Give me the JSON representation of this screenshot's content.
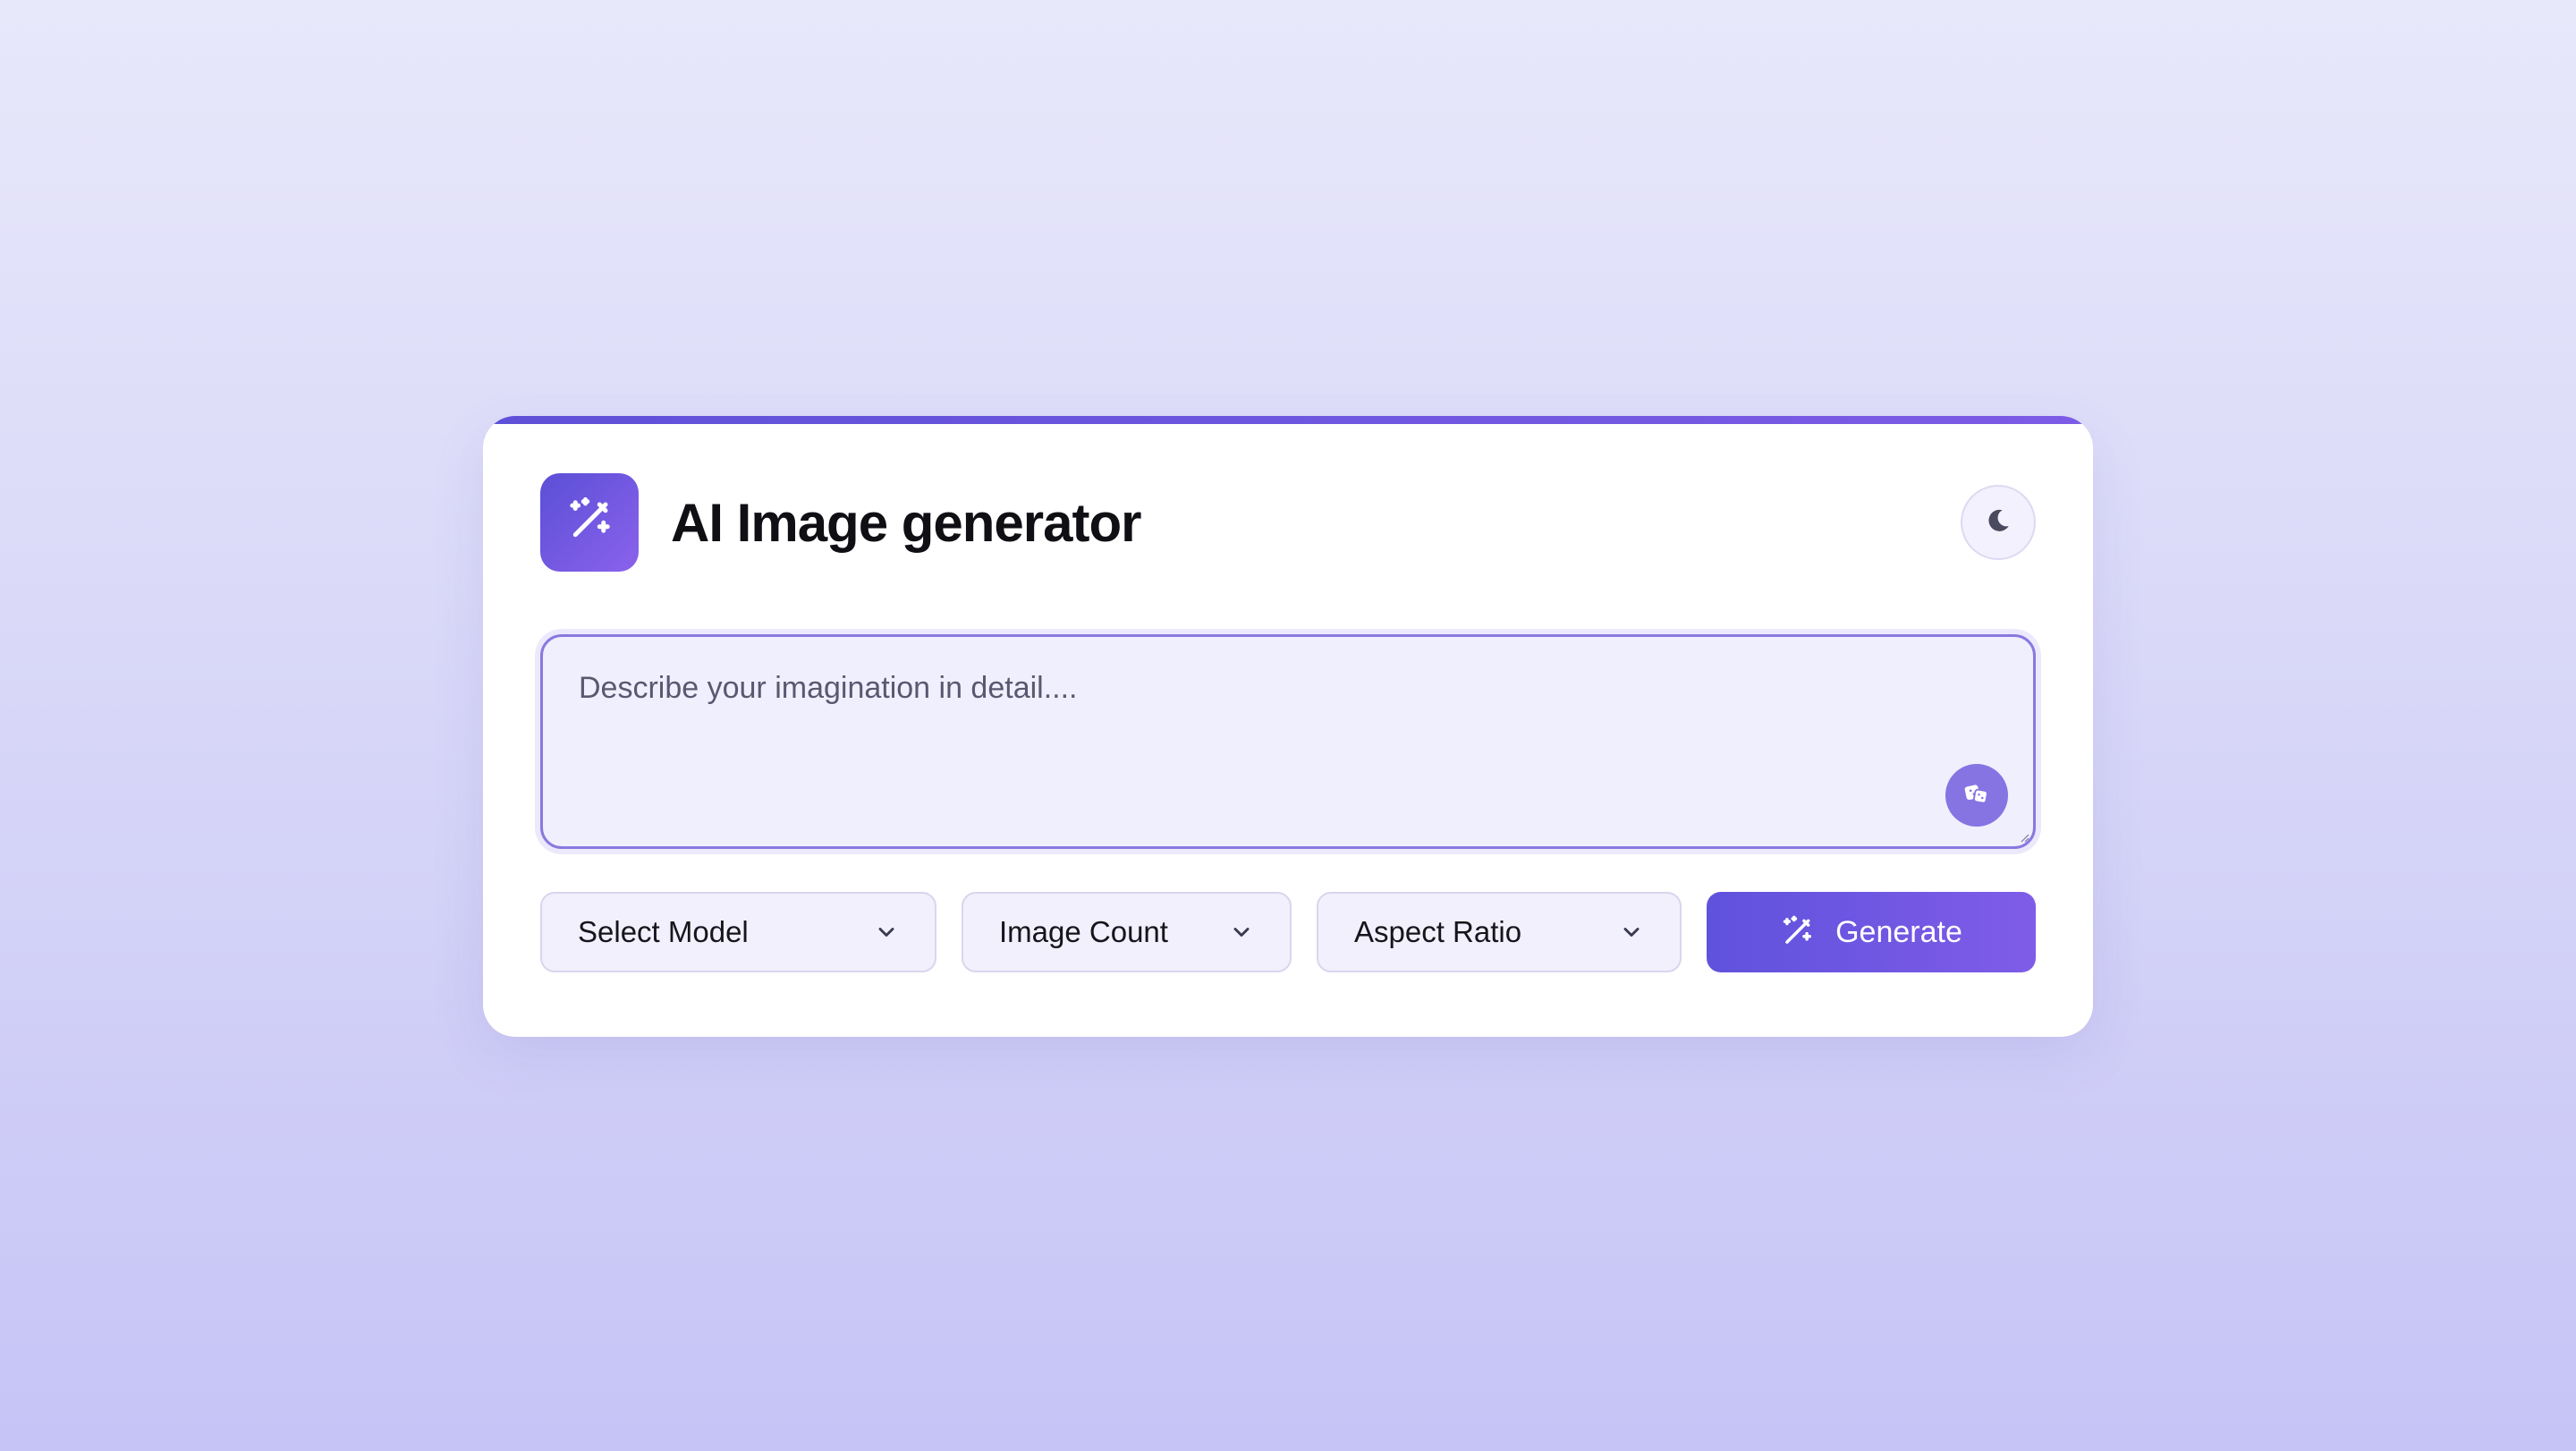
{
  "app": {
    "title": "AI Image generator"
  },
  "prompt": {
    "placeholder": "Describe your imagination in detail....",
    "value": ""
  },
  "controls": {
    "model_label": "Select Model",
    "count_label": "Image Count",
    "ratio_label": "Aspect Ratio",
    "generate_label": "Generate"
  },
  "icons": {
    "logo": "magic-wand-icon",
    "theme": "moon-icon",
    "random": "dice-icon",
    "dropdown": "chevron-down-icon",
    "generate": "magic-wand-icon"
  },
  "colors": {
    "accent_start": "#5e50d8",
    "accent_end": "#8b62ec",
    "input_background": "#f0effd",
    "page_background": "#dcdbf9"
  }
}
